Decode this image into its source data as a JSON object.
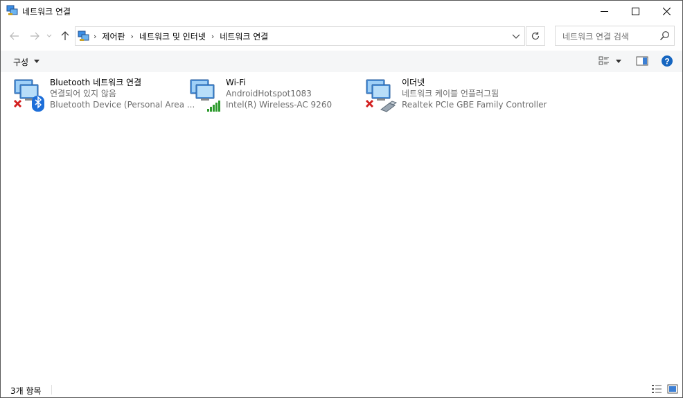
{
  "window": {
    "title": "네트워크 연결"
  },
  "address": {
    "crumbs": [
      "제어판",
      "네트워크 및 인터넷",
      "네트워크 연결"
    ]
  },
  "search": {
    "placeholder": "네트워크 연결 검색"
  },
  "toolbar": {
    "organize_label": "구성"
  },
  "items": [
    {
      "name": "Bluetooth 네트워크 연결",
      "status": "연결되어 있지 않음",
      "device": "Bluetooth Device (Personal Area ...",
      "icon": "bluetooth-network-icon"
    },
    {
      "name": "Wi-Fi",
      "status": "AndroidHotspot1083",
      "device": "Intel(R) Wireless-AC 9260",
      "icon": "wifi-network-icon"
    },
    {
      "name": "이더넷",
      "status": "네트워크 케이블 언플러그됨",
      "device": "Realtek PCIe GBE Family Controller",
      "icon": "ethernet-network-icon"
    }
  ],
  "statusbar": {
    "count_text": "3개 항목"
  },
  "colors": {
    "accent": "#1e6fd9",
    "help": "#1565c0",
    "error": "#d32020",
    "signal": "#2e9b2e"
  }
}
